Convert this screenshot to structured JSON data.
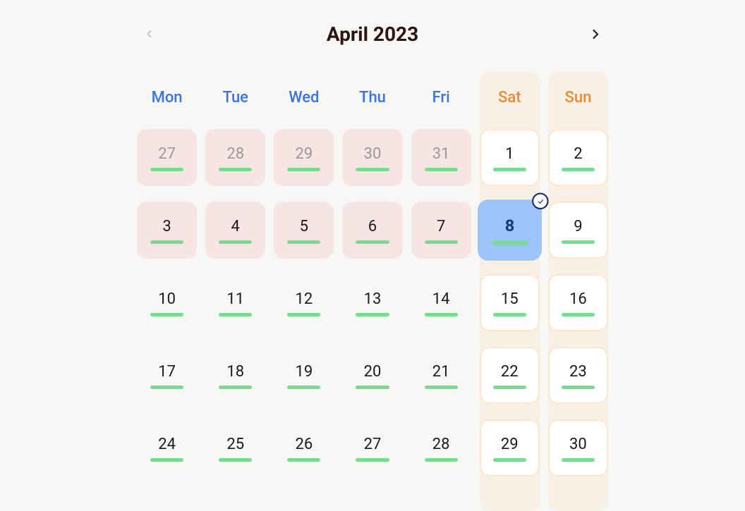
{
  "header": {
    "title": "April 2023",
    "prev_disabled": true
  },
  "weekdays": [
    "Mon",
    "Tue",
    "Wed",
    "Thu",
    "Fri",
    "Sat",
    "Sun"
  ],
  "days": [
    {
      "n": "27",
      "out": true,
      "pastlike": true,
      "weekend": false
    },
    {
      "n": "28",
      "out": true,
      "pastlike": true,
      "weekend": false
    },
    {
      "n": "29",
      "out": true,
      "pastlike": true,
      "weekend": false
    },
    {
      "n": "30",
      "out": true,
      "pastlike": true,
      "weekend": false
    },
    {
      "n": "31",
      "out": true,
      "pastlike": true,
      "weekend": false
    },
    {
      "n": "1",
      "out": false,
      "pastlike": false,
      "weekend": true
    },
    {
      "n": "2",
      "out": false,
      "pastlike": false,
      "weekend": true
    },
    {
      "n": "3",
      "out": false,
      "pastlike": true,
      "weekend": false
    },
    {
      "n": "4",
      "out": false,
      "pastlike": true,
      "weekend": false
    },
    {
      "n": "5",
      "out": false,
      "pastlike": true,
      "weekend": false
    },
    {
      "n": "6",
      "out": false,
      "pastlike": true,
      "weekend": false
    },
    {
      "n": "7",
      "out": false,
      "pastlike": true,
      "weekend": false
    },
    {
      "n": "8",
      "out": false,
      "pastlike": false,
      "weekend": true,
      "selected": true,
      "today": true
    },
    {
      "n": "9",
      "out": false,
      "pastlike": false,
      "weekend": true
    },
    {
      "n": "10",
      "out": false,
      "pastlike": false,
      "weekend": false
    },
    {
      "n": "11",
      "out": false,
      "pastlike": false,
      "weekend": false
    },
    {
      "n": "12",
      "out": false,
      "pastlike": false,
      "weekend": false
    },
    {
      "n": "13",
      "out": false,
      "pastlike": false,
      "weekend": false
    },
    {
      "n": "14",
      "out": false,
      "pastlike": false,
      "weekend": false
    },
    {
      "n": "15",
      "out": false,
      "pastlike": false,
      "weekend": true
    },
    {
      "n": "16",
      "out": false,
      "pastlike": false,
      "weekend": true
    },
    {
      "n": "17",
      "out": false,
      "pastlike": false,
      "weekend": false
    },
    {
      "n": "18",
      "out": false,
      "pastlike": false,
      "weekend": false
    },
    {
      "n": "19",
      "out": false,
      "pastlike": false,
      "weekend": false
    },
    {
      "n": "20",
      "out": false,
      "pastlike": false,
      "weekend": false
    },
    {
      "n": "21",
      "out": false,
      "pastlike": false,
      "weekend": false
    },
    {
      "n": "22",
      "out": false,
      "pastlike": false,
      "weekend": true
    },
    {
      "n": "23",
      "out": false,
      "pastlike": false,
      "weekend": true
    },
    {
      "n": "24",
      "out": false,
      "pastlike": false,
      "weekend": false
    },
    {
      "n": "25",
      "out": false,
      "pastlike": false,
      "weekend": false
    },
    {
      "n": "26",
      "out": false,
      "pastlike": false,
      "weekend": false
    },
    {
      "n": "27",
      "out": false,
      "pastlike": false,
      "weekend": false
    },
    {
      "n": "28",
      "out": false,
      "pastlike": false,
      "weekend": false
    },
    {
      "n": "29",
      "out": false,
      "pastlike": false,
      "weekend": true
    },
    {
      "n": "30",
      "out": false,
      "pastlike": false,
      "weekend": true
    }
  ]
}
